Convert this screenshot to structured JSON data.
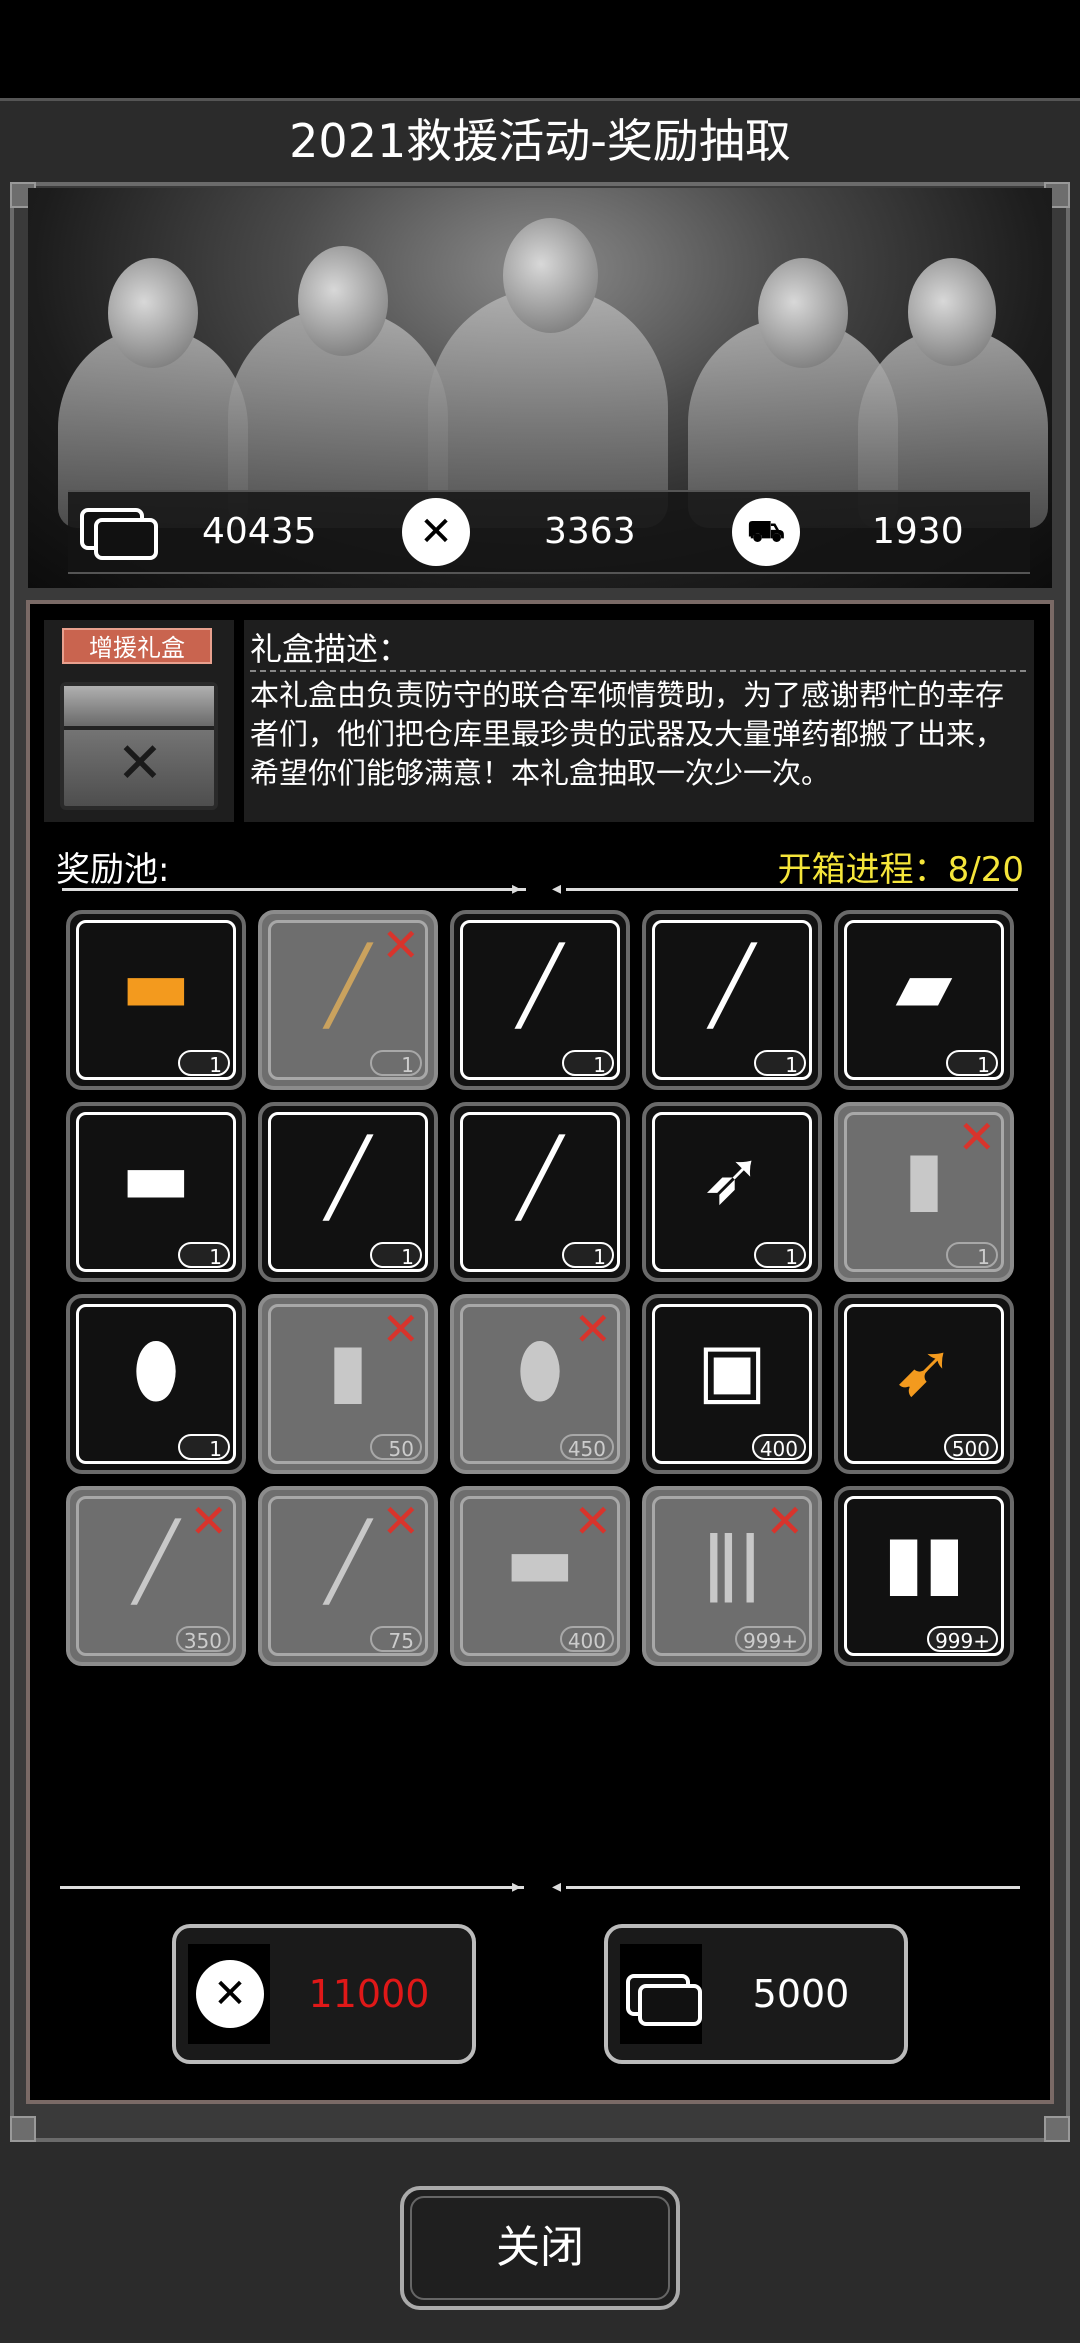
{
  "dialog": {
    "title": "2021救援活动-奖励抽取"
  },
  "currencies": [
    {
      "icon": "card-icon",
      "value": "40435"
    },
    {
      "icon": "swords-badge-icon",
      "value": "3363"
    },
    {
      "icon": "car-badge-icon",
      "value": "1930"
    }
  ],
  "gift_box": {
    "label": "增援礼盒",
    "desc_title": "礼盒描述：",
    "desc_text": "本礼盒由负责防守的联合军倾情赞助，为了感谢帮忙的幸存者们，他们把仓库里最珍贵的武器及大量弹药都搬了出来，希望你们能够满意！本礼盒抽取一次少一次。"
  },
  "pool": {
    "label": "奖励池:",
    "progress": "开箱进程：8/20",
    "items": [
      {
        "icon": "grenade-launcher-icon",
        "qty": "1",
        "taken": false
      },
      {
        "icon": "spiked-hammer-icon",
        "qty": "1",
        "taken": true
      },
      {
        "icon": "sniper-rifle-icon",
        "qty": "1",
        "taken": false
      },
      {
        "icon": "rocket-launcher-icon",
        "qty": "1",
        "taken": false
      },
      {
        "icon": "minigun-icon",
        "qty": "1",
        "taken": false
      },
      {
        "icon": "drum-grenade-launcher-icon",
        "qty": "1",
        "taken": false
      },
      {
        "icon": "assault-rifle-icon",
        "qty": "1",
        "taken": false
      },
      {
        "icon": "shotgun-icon",
        "qty": "1",
        "taken": false
      },
      {
        "icon": "spear-icon",
        "qty": "1",
        "taken": false
      },
      {
        "icon": "armor-plate-icon",
        "qty": "1",
        "taken": true
      },
      {
        "icon": "riot-shield-icon",
        "qty": "1",
        "taken": false
      },
      {
        "icon": "flashbang-icon",
        "qty": "50",
        "taken": true
      },
      {
        "icon": "frag-grenade-icon",
        "qty": "450",
        "taken": true
      },
      {
        "icon": "incendiary-grenade-icon",
        "qty": "400",
        "taken": false
      },
      {
        "icon": "rocket-ammo-icon",
        "qty": "500",
        "taken": false
      },
      {
        "icon": "rifle-rounds-icon",
        "qty": "350",
        "taken": true
      },
      {
        "icon": "rpg-round-icon",
        "qty": "75",
        "taken": true
      },
      {
        "icon": "shotgun-shells-icon",
        "qty": "400",
        "taken": true
      },
      {
        "icon": "bullets-icon",
        "qty": "999+",
        "taken": true
      },
      {
        "icon": "pistol-rounds-icon",
        "qty": "999+",
        "taken": false
      }
    ]
  },
  "buttons": {
    "draw_badge_price": "11000",
    "draw_badge_price_color": "#e01818",
    "draw_card_price": "5000",
    "close": "关闭"
  }
}
